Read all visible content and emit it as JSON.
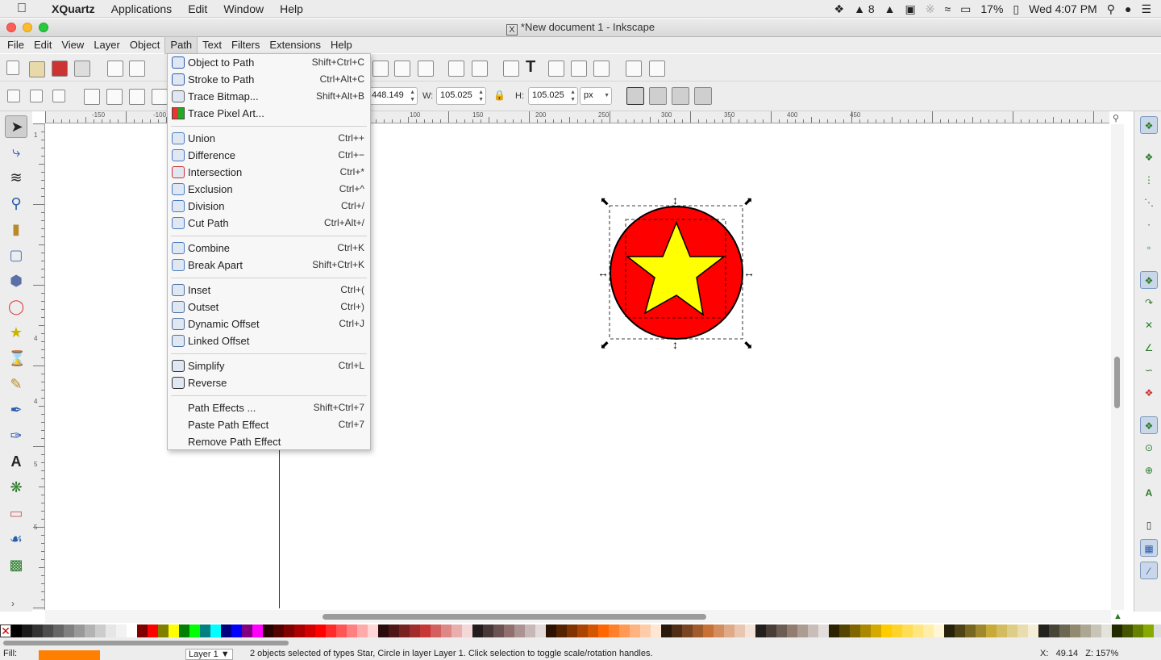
{
  "mac_menubar": {
    "app": "XQuartz",
    "items": [
      "Applications",
      "Edit",
      "Window",
      "Help"
    ],
    "status": {
      "notifications": "8",
      "battery": "17%",
      "clock": "Wed 4:07 PM"
    }
  },
  "window": {
    "title": "*New document 1 - Inkscape"
  },
  "app_menu": [
    "File",
    "Edit",
    "View",
    "Layer",
    "Object",
    "Path",
    "Text",
    "Filters",
    "Extensions",
    "Help"
  ],
  "controls": {
    "x_value": "448.149",
    "w_label": "W:",
    "w_value": "105.025",
    "h_label": "H:",
    "h_value": "105.025",
    "unit": "px"
  },
  "ruler": {
    "h_labels": [
      "-150",
      "-100",
      "100",
      "150",
      "200",
      "250",
      "300",
      "350",
      "400",
      "450"
    ],
    "v_labels": [
      "1",
      "4",
      "4",
      "5",
      "5"
    ]
  },
  "path_menu": {
    "groups": [
      [
        {
          "label": "Object to Path",
          "shortcut": "Shift+Ctrl+C",
          "icon": "object-to-path-icon"
        },
        {
          "label": "Stroke to Path",
          "shortcut": "Ctrl+Alt+C",
          "icon": "stroke-to-path-icon"
        },
        {
          "label": "Trace Bitmap...",
          "shortcut": "Shift+Alt+B",
          "icon": "trace-bitmap-icon"
        },
        {
          "label": "Trace Pixel Art...",
          "shortcut": "",
          "icon": "trace-pixel-art-icon"
        }
      ],
      [
        {
          "label": "Union",
          "shortcut": "Ctrl++",
          "icon": "union-icon"
        },
        {
          "label": "Difference",
          "shortcut": "Ctrl+−",
          "icon": "difference-icon"
        },
        {
          "label": "Intersection",
          "shortcut": "Ctrl+*",
          "icon": "intersection-icon"
        },
        {
          "label": "Exclusion",
          "shortcut": "Ctrl+^",
          "icon": "exclusion-icon"
        },
        {
          "label": "Division",
          "shortcut": "Ctrl+/",
          "icon": "division-icon"
        },
        {
          "label": "Cut Path",
          "shortcut": "Ctrl+Alt+/",
          "icon": "cut-path-icon"
        }
      ],
      [
        {
          "label": "Combine",
          "shortcut": "Ctrl+K",
          "icon": "combine-icon"
        },
        {
          "label": "Break Apart",
          "shortcut": "Shift+Ctrl+K",
          "icon": "break-apart-icon"
        }
      ],
      [
        {
          "label": "Inset",
          "shortcut": "Ctrl+(",
          "icon": "inset-icon"
        },
        {
          "label": "Outset",
          "shortcut": "Ctrl+)",
          "icon": "outset-icon"
        },
        {
          "label": "Dynamic Offset",
          "shortcut": "Ctrl+J",
          "icon": "dynamic-offset-icon"
        },
        {
          "label": "Linked Offset",
          "shortcut": "",
          "icon": "linked-offset-icon"
        }
      ],
      [
        {
          "label": "Simplify",
          "shortcut": "Ctrl+L",
          "icon": "simplify-icon"
        },
        {
          "label": "Reverse",
          "shortcut": "",
          "icon": "reverse-icon"
        }
      ],
      [
        {
          "label": "Path Effects ...",
          "shortcut": "Shift+Ctrl+7",
          "icon": ""
        },
        {
          "label": "Paste Path Effect",
          "shortcut": "Ctrl+7",
          "icon": ""
        },
        {
          "label": "Remove Path Effect",
          "shortcut": "",
          "icon": ""
        }
      ]
    ]
  },
  "drawing": {
    "circle_fill": "#ff0000",
    "star_fill": "#ffff00",
    "stroke": "#000000"
  },
  "palette": [
    "#000000",
    "#1a1a1a",
    "#333333",
    "#4d4d4d",
    "#666666",
    "#808080",
    "#999999",
    "#b3b3b3",
    "#cccccc",
    "#e6e6e6",
    "#f2f2f2",
    "#ffffff",
    "#800000",
    "#ff0000",
    "#808000",
    "#ffff00",
    "#008000",
    "#00ff00",
    "#008080",
    "#00ffff",
    "#000080",
    "#0000ff",
    "#800080",
    "#ff00ff",
    "#2b0000",
    "#550000",
    "#800000",
    "#aa0000",
    "#d40000",
    "#ff0000",
    "#ff2a2a",
    "#ff5555",
    "#ff8080",
    "#ffaaaa",
    "#ffd5d5",
    "#280b0b",
    "#501616",
    "#782121",
    "#a02c2c",
    "#c83737",
    "#d35f5f",
    "#de8787",
    "#e9afaf",
    "#f4d7d7",
    "#241c1c",
    "#483737",
    "#6c5353",
    "#916f6f",
    "#ac9393",
    "#c8b7b7",
    "#e3dbdb",
    "#2b1100",
    "#552200",
    "#803300",
    "#aa4400",
    "#d45500",
    "#ff6600",
    "#ff7f2a",
    "#ff9955",
    "#ffb380",
    "#ffccaa",
    "#ffe6d5",
    "#28170b",
    "#502d16",
    "#784421",
    "#a05a2c",
    "#c87137",
    "#d38d5f",
    "#deaa87",
    "#e9c6af",
    "#f4e3d7",
    "#241f1c",
    "#483e37",
    "#6c5d53",
    "#917c6f",
    "#ac9d93",
    "#c8beb7",
    "#e3dedb",
    "#2b2200",
    "#554400",
    "#806600",
    "#aa8800",
    "#d4aa00",
    "#ffcc00",
    "#ffd42a",
    "#ffdd55",
    "#ffe680",
    "#ffeeaa",
    "#fff6d5",
    "#28220b",
    "#504416",
    "#786721",
    "#a0892c",
    "#c8ab37",
    "#d3bc5f",
    "#decd87",
    "#e9ddaf",
    "#f4eed7",
    "#24221c",
    "#484537",
    "#6c6753",
    "#918a6f",
    "#aca793",
    "#c8c4b7",
    "#e3e2db",
    "#222b00",
    "#445500",
    "#668000",
    "#88aa00"
  ],
  "status": {
    "fill_label": "Fill:",
    "message": "2 objects selected of types Star, Circle in layer Layer 1. Click selection to toggle scale/rotation handles.",
    "layer": "Layer 1",
    "x_label": "X:",
    "x_value": "49.14",
    "zoom": "157%"
  }
}
